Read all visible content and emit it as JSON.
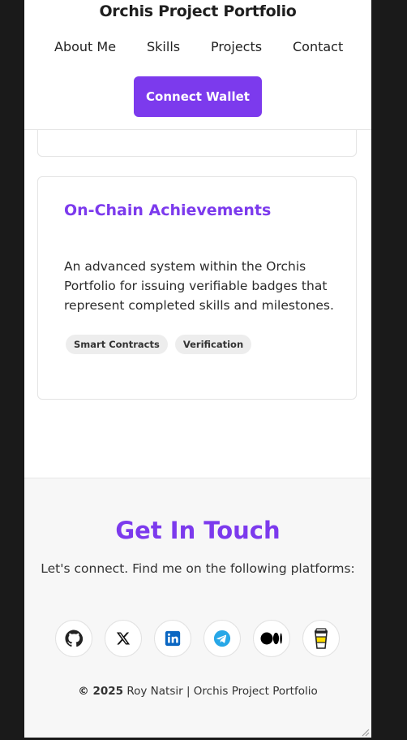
{
  "header": {
    "title": "Orchis Project Portfolio",
    "nav": [
      "About Me",
      "Skills",
      "Projects",
      "Contact"
    ],
    "connect_label": "Connect Wallet"
  },
  "project": {
    "title": "On-Chain Achievements",
    "description": "An advanced system within the Orchis Portfolio for issuing verifiable badges that represent completed skills and milestones.",
    "tags": [
      "Smart Contracts",
      "Verification"
    ]
  },
  "contact": {
    "title": "Get In Touch",
    "subtitle": "Let's connect. Find me on the following platforms:",
    "socials": [
      "github-icon",
      "x-icon",
      "linkedin-icon",
      "telegram-icon",
      "medium-icon",
      "coffee-icon"
    ]
  },
  "footer": {
    "year": "© 2025",
    "text": " Roy Natsir | Orchis Project Portfolio"
  },
  "colors": {
    "accent": "#7c3aed",
    "background": "#1a1a1a"
  }
}
